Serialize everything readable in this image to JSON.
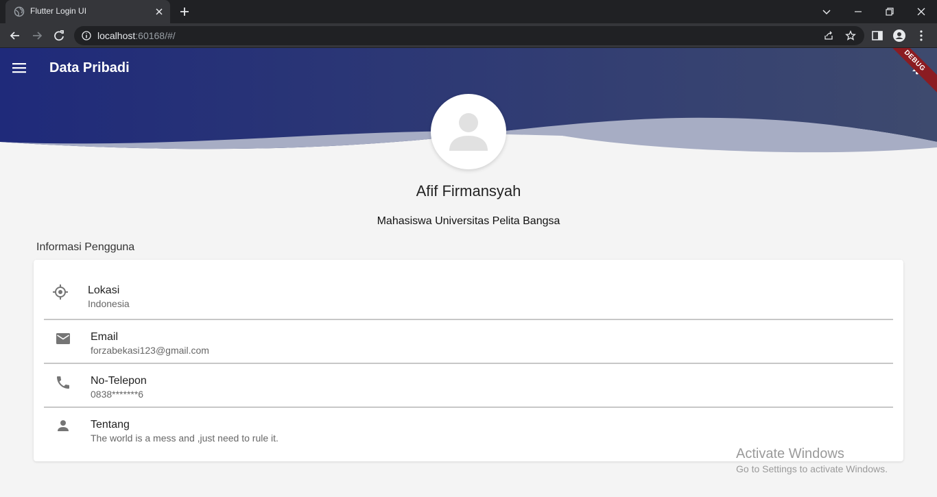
{
  "browser": {
    "tab_title": "Flutter Login UI",
    "url_host": "localhost",
    "url_rest": ":60168/#/"
  },
  "app": {
    "title": "Data Pribadi",
    "debug_label": "DEBUG"
  },
  "profile": {
    "name": "Afif Firmansyah",
    "subtitle": "Mahasiswa Universitas Pelita Bangsa"
  },
  "section_title": "Informasi Pengguna",
  "info_items": [
    {
      "icon": "location-icon",
      "label": "Lokasi",
      "value": "Indonesia"
    },
    {
      "icon": "email-icon",
      "label": "Email",
      "value": "forzabekasi123@gmail.com"
    },
    {
      "icon": "phone-icon",
      "label": "No-Telepon",
      "value": "0838*******6"
    },
    {
      "icon": "person-icon",
      "label": "Tentang",
      "value": "The world is a mess and ,just need to rule it."
    }
  ],
  "watermark": {
    "title": "Activate Windows",
    "subtitle": "Go to Settings to activate Windows."
  },
  "colors": {
    "header_dark": "#1f2a7a",
    "header_light": "#3e4a6e",
    "wave": "#a7adc4",
    "page_bg": "#f4f4f4"
  }
}
